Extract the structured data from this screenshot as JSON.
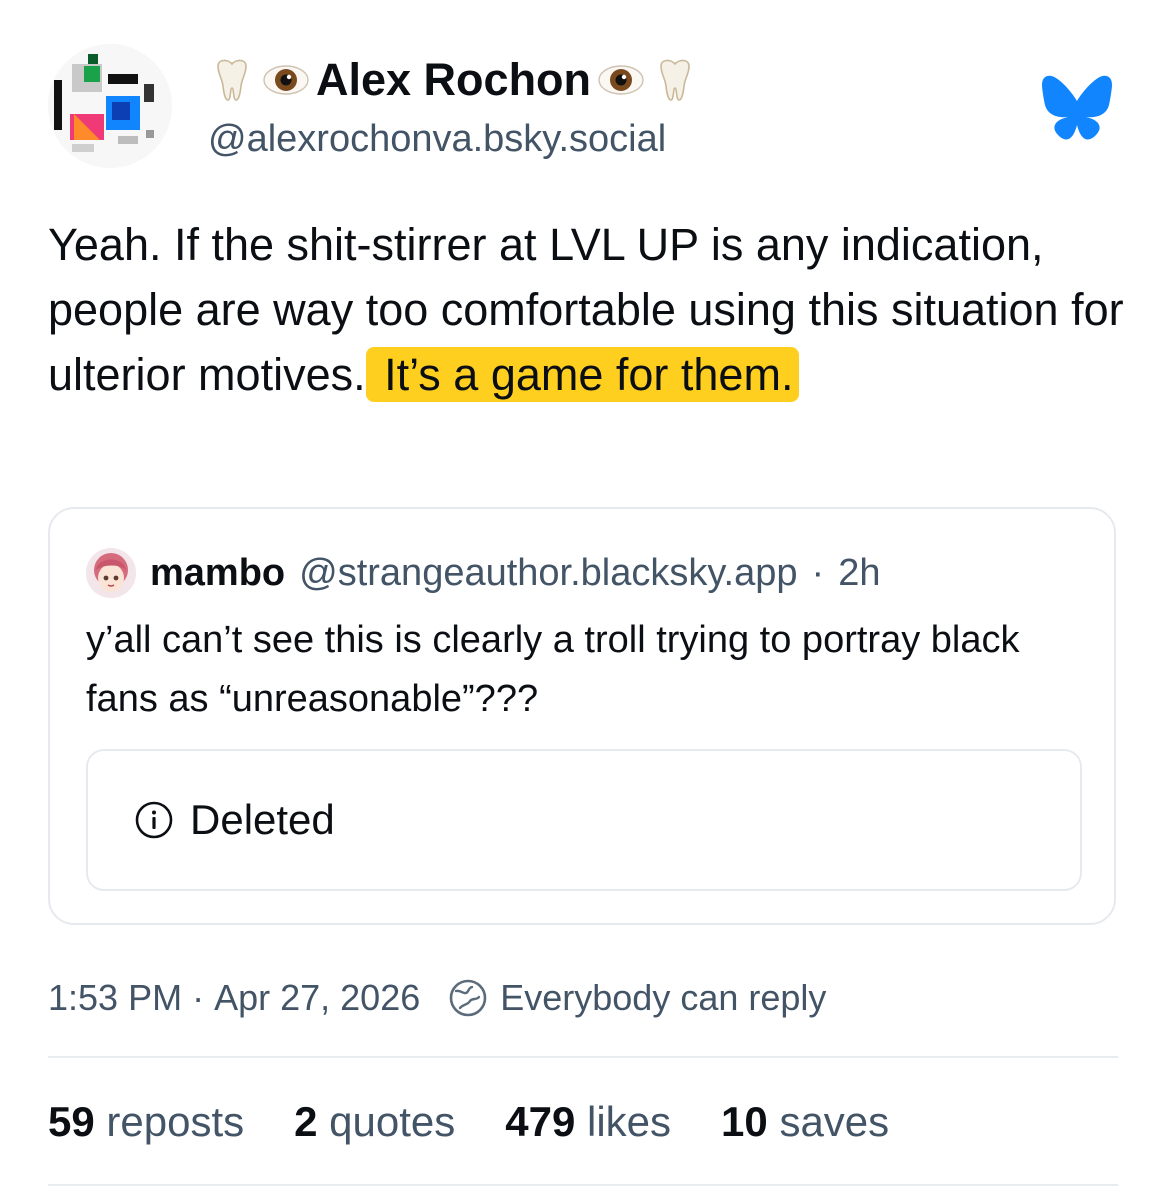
{
  "author": {
    "display_name": "Alex Rochon",
    "handle": "@alexrochonva.bsky.social",
    "name_decoration_icons": [
      "tooth-icon",
      "eye-icon",
      "eye-icon",
      "tooth-icon"
    ]
  },
  "post": {
    "text_plain": "Yeah. If the shit-stirrer at LVL UP is any indication, people are way too comfortable using this situation for ulterior motives.",
    "text_highlighted": " It’s a game for them.",
    "highlight_color": "#ffcf1f"
  },
  "quoted_post": {
    "author_name": "mambo",
    "author_handle": "@strangeauthor.blacksky.app",
    "separator": "·",
    "age": "2h",
    "text": "y’all can’t see this is clearly a troll trying to portray black fans as “unreasonable”???",
    "embed_status": "Deleted",
    "embed_icon": "info-icon"
  },
  "meta": {
    "time": "1:53 PM",
    "separator": "·",
    "date": "Apr 27, 2026",
    "reply_setting": "Everybody can reply",
    "reply_icon": "globe-icon"
  },
  "stats": {
    "reposts": {
      "count": "59",
      "label": "reposts"
    },
    "quotes": {
      "count": "2",
      "label": "quotes"
    },
    "likes": {
      "count": "479",
      "label": "likes"
    },
    "saves": {
      "count": "10",
      "label": "saves"
    }
  },
  "colors": {
    "brand": "#1185fe",
    "text": "#0b0f14",
    "secondary_text": "#425466",
    "border": "#e6e9ee"
  }
}
